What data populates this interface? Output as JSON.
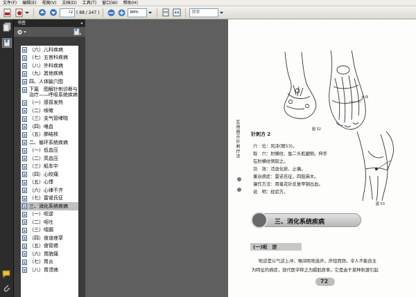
{
  "menu": [
    "文件(F)",
    "编辑(E)",
    "视图(V)",
    "文档(D)",
    "工具(T)",
    "窗口(W)",
    "帮助(H)"
  ],
  "toolbar": {
    "page_value": "72",
    "page_total": "( 88 / 247 )",
    "zoom_value": "88%",
    "search_placeholder": "搜索"
  },
  "bookmarks": {
    "panel_title": "书签",
    "items": [
      "（六）儿科疾病",
      "（七）五官科疾病",
      "（八）外科疾病",
      "（九）其他疾病",
      "四、人体腧穴图",
      "下篇　图解针刺诊断与治疗——呼吸系统疾病",
      "（一）感冒发热",
      "（二）咳嗽",
      "（三）支气管哮喘",
      "（四）咯血",
      "（五）肺结核",
      "二、循环系统疾病",
      "（一）低血压",
      "（二）高血压",
      "（三）船车中",
      "（四）心绞痛",
      "（五）心悸",
      "（六）心律不齐",
      "（七）雷诺氏征",
      "三、消化系统疾病",
      "（一）呃逆",
      "（二）呕吐",
      "（三）噎膈",
      "（四）食道痉挛",
      "（五）食管癌",
      "（六）胃脘痛",
      "（七）胃炎",
      "（八）胃溃疡"
    ],
    "selected_index": 19
  },
  "page": {
    "side_title": "实用图示针刺疗法",
    "fig52_label": "图 52",
    "fig52_annotation": "太冲",
    "fig53_label": "图 53",
    "method_title": "针刺方 2",
    "lines": [
      "穴　位：风泽(图53)。",
      "取　穴：肘横纹、肱二头肌腱侧。伸手",
      "在肘横纹侧取之。",
      "功　效：活血化瘀、止痛。",
      "兼治病症：雷诺氏征，四肢麻木。",
      "操作方法：用毫花针反复甲钢出血。",
      "说　明：经验方。"
    ],
    "section_banner": "三、消化系统疾病",
    "subsection": "(一)呃　逆",
    "body_lines": [
      "呃逆是以气逆上冲，喉间呃呃连声，声短而频，令人不能自主",
      "为特征的病症，现代医学称之为膈肌痉挛。它是由于某种刺激引起"
    ],
    "page_number": "72"
  },
  "colors": {
    "pdf_icon": "#c0201e",
    "panel_dark": "#3b3b3b",
    "doc_bg": "#5f5f5f",
    "selected_bookmark": "#c0c0c0"
  }
}
